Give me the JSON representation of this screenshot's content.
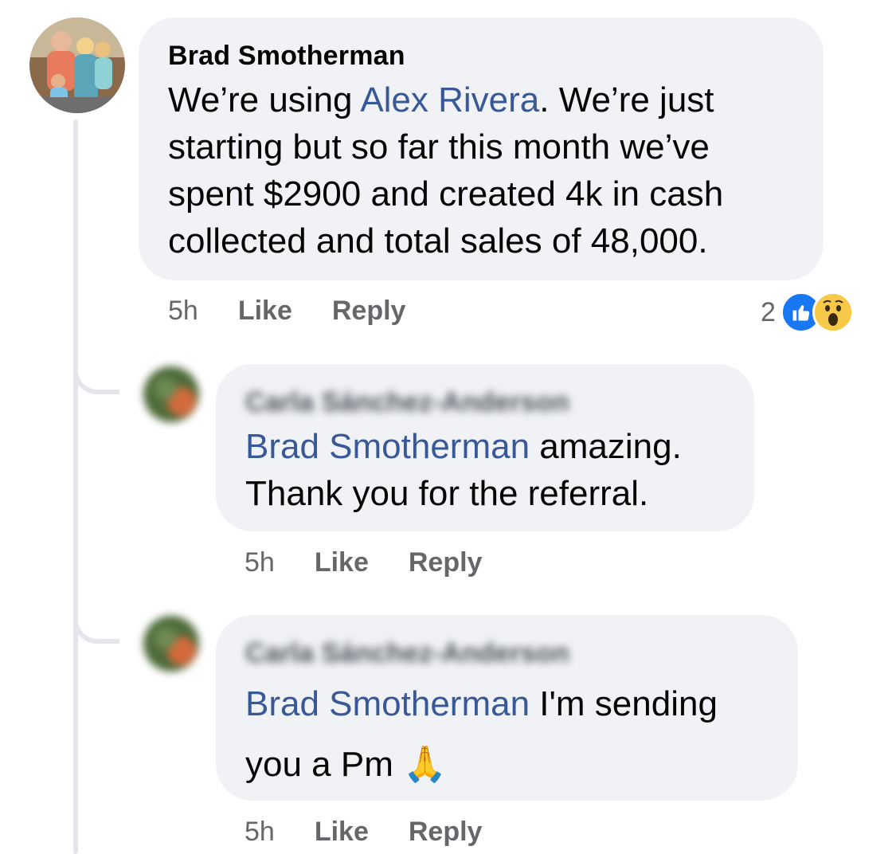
{
  "comments": [
    {
      "author": "Brad Smotherman",
      "text_before": "We’re using ",
      "mention": "Alex Rivera",
      "text_after": ". We’re just starting but so far this month we’ve spent $2900 and created 4k in cash collected and total sales of 48,000.",
      "time": "5h",
      "like_label": "Like",
      "reply_label": "Reply",
      "reaction_count": "2",
      "reaction_icons": [
        "like-icon",
        "wow-icon"
      ]
    }
  ],
  "replies": [
    {
      "author": "Carla Sánchez-Anderson",
      "mention": "Brad Smotherman",
      "text_after": " amazing. Thank you for the referral.",
      "time": "5h",
      "like_label": "Like",
      "reply_label": "Reply"
    },
    {
      "author": "Carla Sánchez-Anderson",
      "mention": "Brad Smotherman",
      "text_after": " I'm sending you a Pm ",
      "emoji": "🙏",
      "time": "5h",
      "like_label": "Like",
      "reply_label": "Reply"
    }
  ],
  "colors": {
    "mention": "#385898",
    "bubble": "#f0f2f5",
    "meta": "#65676b",
    "like_blue": "#1877f2"
  }
}
